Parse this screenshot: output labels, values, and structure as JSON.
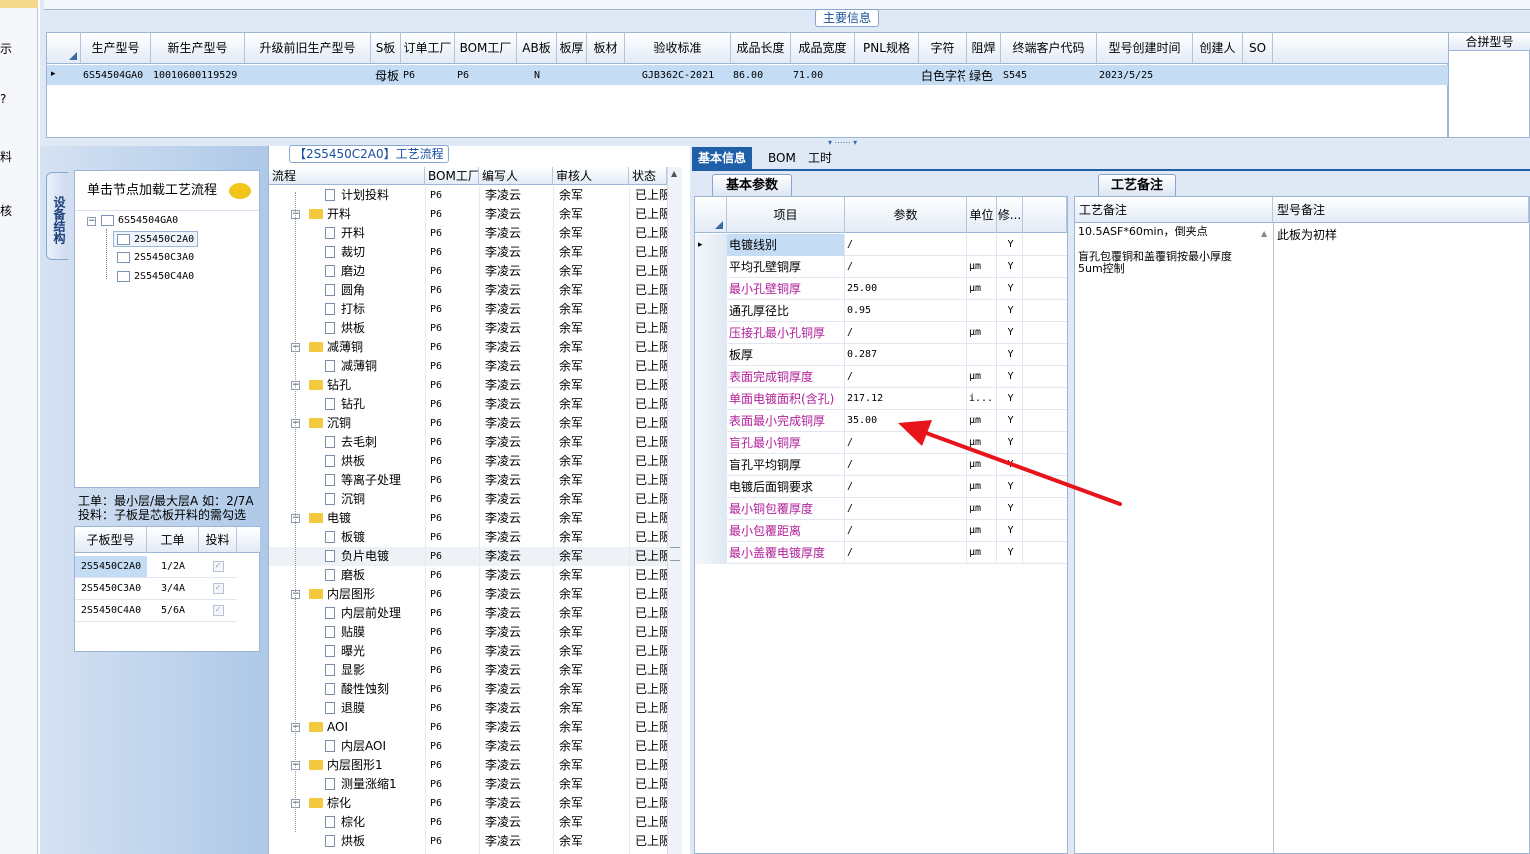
{
  "left_nav": [
    "示",
    "?",
    "料",
    "核"
  ],
  "main_info": {
    "caption": "主要信息",
    "headers": [
      "生产型号",
      "新生产型号",
      "升级前旧生产型号",
      "S板",
      "订单工厂",
      "BOM工厂",
      "AB板",
      "板厚",
      "板材",
      "验收标准",
      "成品长度",
      "成品宽度",
      "PNL规格",
      "字符",
      "阻焊",
      "终端客户代码",
      "型号创建时间",
      "创建人",
      "SO"
    ],
    "row": [
      "6S54504GA0",
      "10010600119529",
      "",
      "母板",
      "P6",
      "P6",
      "N",
      "",
      "",
      "GJB362C-2021",
      "86.00",
      "71.00",
      "",
      "白色字符",
      "绿色",
      "S545",
      "2023/5/25",
      "",
      ""
    ],
    "merge_header": "合拼型号"
  },
  "left_panel": {
    "vtab": "设备结构",
    "tree_header": "单击节点加载工艺流程",
    "root": "6S54504GA0",
    "children": [
      "2S5450C2A0",
      "2S5450C3A0",
      "2S5450C4A0"
    ],
    "note1": "工单：最小层/最大层A 如：2/7A",
    "note2": "投料：子板是芯板开料的需勾选",
    "subgrid_headers": [
      "子板型号",
      "工单",
      "投料"
    ],
    "subgrid_rows": [
      [
        "2S5450C2A0",
        "1/2A"
      ],
      [
        "2S5450C3A0",
        "3/4A"
      ],
      [
        "2S5450C4A0",
        "5/6A"
      ]
    ]
  },
  "process": {
    "caption": "【2S5450C2A0】工艺流程",
    "headers": [
      "流程",
      "BOM工厂",
      "编写人",
      "审核人",
      "状态"
    ],
    "factory": "P6",
    "writer": "李凌云",
    "reviewer": "余军",
    "status": "已上阪",
    "rows": [
      {
        "name": "计划投料",
        "folder": false
      },
      {
        "name": "开料",
        "folder": true
      },
      {
        "name": "开料",
        "folder": false
      },
      {
        "name": "裁切",
        "folder": false
      },
      {
        "name": "磨边",
        "folder": false
      },
      {
        "name": "圆角",
        "folder": false
      },
      {
        "name": "打标",
        "folder": false
      },
      {
        "name": "烘板",
        "folder": false
      },
      {
        "name": "减薄铜",
        "folder": true
      },
      {
        "name": "减薄铜",
        "folder": false
      },
      {
        "name": "钻孔",
        "folder": true
      },
      {
        "name": "钻孔",
        "folder": false
      },
      {
        "name": "沉铜",
        "folder": true
      },
      {
        "name": "去毛刺",
        "folder": false
      },
      {
        "name": "烘板",
        "folder": false
      },
      {
        "name": "等离子处理",
        "folder": false
      },
      {
        "name": "沉铜",
        "folder": false
      },
      {
        "name": "电镀",
        "folder": true
      },
      {
        "name": "板镀",
        "folder": false
      },
      {
        "name": "负片电镀",
        "folder": false
      },
      {
        "name": "磨板",
        "folder": false
      },
      {
        "name": "内层图形",
        "folder": true
      },
      {
        "name": "内层前处理",
        "folder": false
      },
      {
        "name": "贴膜",
        "folder": false
      },
      {
        "name": "曝光",
        "folder": false
      },
      {
        "name": "显影",
        "folder": false
      },
      {
        "name": "酸性蚀刻",
        "folder": false
      },
      {
        "name": "退膜",
        "folder": false
      },
      {
        "name": "AOI",
        "folder": true
      },
      {
        "name": "内层AOI",
        "folder": false
      },
      {
        "name": "内层图形1",
        "folder": true
      },
      {
        "name": "测量涨缩1",
        "folder": false
      },
      {
        "name": "棕化",
        "folder": true
      },
      {
        "name": "棕化",
        "folder": false
      },
      {
        "name": "烘板",
        "folder": false
      }
    ]
  },
  "tabs": [
    "基本信息",
    "BOM",
    "工时"
  ],
  "basic_params": {
    "tab": "基本参数",
    "headers": [
      "项目",
      "参数",
      "单位",
      "修..."
    ],
    "rows": [
      {
        "item": "电镀线别",
        "param": "/",
        "unit": "",
        "mod": "Y",
        "magenta": false
      },
      {
        "item": "平均孔壁铜厚",
        "param": "/",
        "unit": "μm",
        "mod": "Y",
        "magenta": false
      },
      {
        "item": "最小孔壁铜厚",
        "param": "25.00",
        "unit": "μm",
        "mod": "Y",
        "magenta": true
      },
      {
        "item": "通孔厚径比",
        "param": "0.95",
        "unit": "",
        "mod": "Y",
        "magenta": false
      },
      {
        "item": "压接孔最小孔铜厚",
        "param": "/",
        "unit": "μm",
        "mod": "Y",
        "magenta": true
      },
      {
        "item": "板厚",
        "param": "0.287",
        "unit": "",
        "mod": "Y",
        "magenta": false
      },
      {
        "item": "表面完成铜厚度",
        "param": "/",
        "unit": "μm",
        "mod": "Y",
        "magenta": true
      },
      {
        "item": "单面电镀面积(含孔)",
        "param": "217.12",
        "unit": "i...",
        "mod": "Y",
        "magenta": true
      },
      {
        "item": "表面最小完成铜厚",
        "param": "35.00",
        "unit": "μm",
        "mod": "Y",
        "magenta": true
      },
      {
        "item": "盲孔最小铜厚",
        "param": "/",
        "unit": "μm",
        "mod": "Y",
        "magenta": true
      },
      {
        "item": "盲孔平均铜厚",
        "param": "/",
        "unit": "μm",
        "mod": "Y",
        "magenta": false
      },
      {
        "item": "电镀后面铜要求",
        "param": "/",
        "unit": "μm",
        "mod": "Y",
        "magenta": false
      },
      {
        "item": "最小铜包覆厚度",
        "param": "/",
        "unit": "μm",
        "mod": "Y",
        "magenta": true
      },
      {
        "item": "最小包覆距离",
        "param": "/",
        "unit": "μm",
        "mod": "Y",
        "magenta": true
      },
      {
        "item": "最小盖覆电镀厚度",
        "param": "/",
        "unit": "μm",
        "mod": "Y",
        "magenta": true
      }
    ]
  },
  "process_notes": {
    "tab": "工艺备注",
    "headers": [
      "工艺备注",
      "型号备注"
    ],
    "note_line1": "10.5ASF*60min，倒夹点",
    "note_line2": "盲孔包覆铜和盖覆铜按最小厚度",
    "note_line3": "5um控制",
    "model_note": "此板为初样"
  },
  "colors": {
    "accent": "#1f5fa8",
    "selected_row": "#c5dcf5",
    "magenta_label": "#b0209a",
    "arrow": "#e8141c"
  }
}
